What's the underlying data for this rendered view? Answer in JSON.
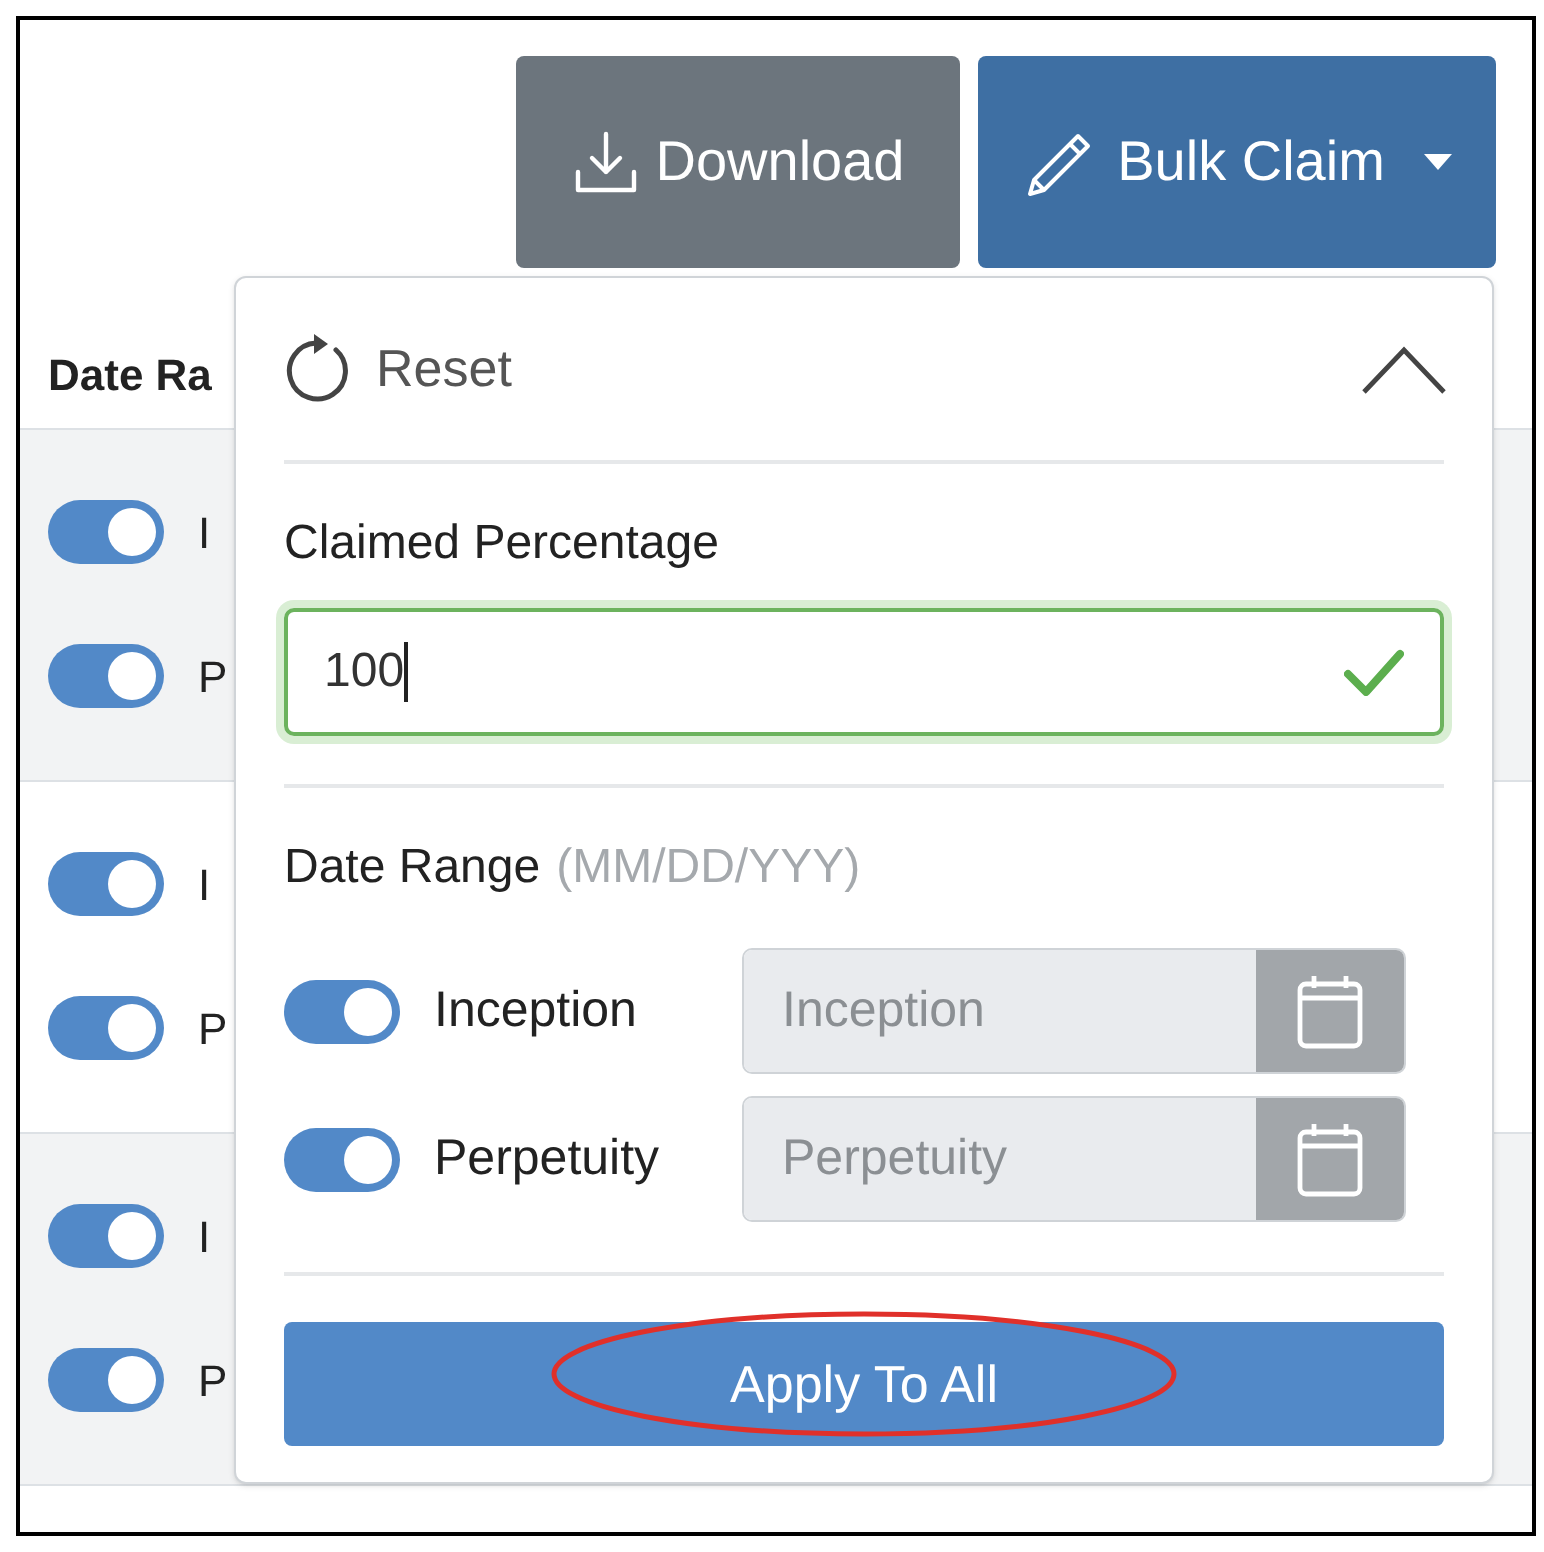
{
  "toolbar": {
    "buttons": [
      {
        "kind": "download",
        "label": "Download"
      },
      {
        "kind": "dropdown",
        "label": "Bulk Claim",
        "expanded": true
      }
    ]
  },
  "table": {
    "header": "Date Ra",
    "row_groups": [
      {
        "toggles": [
          {
            "label": "I",
            "on": true
          },
          {
            "label": "P",
            "on": true
          }
        ]
      },
      {
        "toggles": [
          {
            "label": "I",
            "on": true
          },
          {
            "label": "P",
            "on": true
          }
        ]
      },
      {
        "toggles": [
          {
            "label": "I",
            "on": true
          },
          {
            "label": "P",
            "on": true
          }
        ]
      }
    ]
  },
  "bulk_claim_panel": {
    "reset": "Reset",
    "claimed_percentage": {
      "label": "Claimed Percentage",
      "value": "100",
      "valid": true
    },
    "date_range": {
      "label": "Date Range",
      "hint": "(MM/DD/YYY)",
      "rows": [
        {
          "label": "Inception",
          "on": true,
          "placeholder": "Inception"
        },
        {
          "label": "Perpetuity",
          "on": true,
          "placeholder": "Perpetuity"
        }
      ]
    },
    "apply_button": "Apply To All"
  },
  "annotations": [
    {
      "kind": "ellipse"
    }
  ]
}
